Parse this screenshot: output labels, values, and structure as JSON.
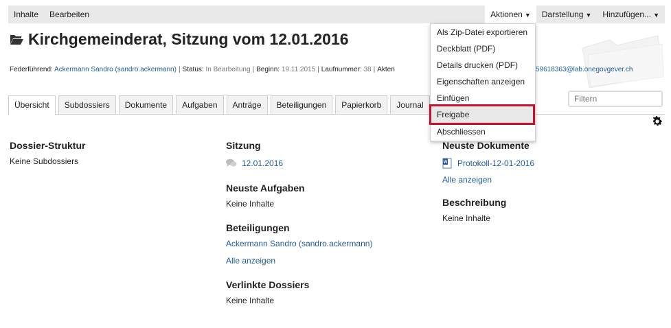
{
  "topbar": {
    "left": [
      "Inhalte",
      "Bearbeiten"
    ],
    "right": [
      {
        "label": "Aktionen",
        "caret": "▼"
      },
      {
        "label": "Darstellung",
        "caret": "▼"
      },
      {
        "label": "Hinzufügen...",
        "caret": "▼"
      }
    ]
  },
  "page_title": "Kirchgemeinderat, Sitzung vom 12.01.2016",
  "meta": {
    "federfuehrend_label": "Federführend:",
    "federfuehrend_value": "Ackermann Sandro (sandro.ackermann)",
    "status_label": "Status:",
    "status_value": "In Bearbeitung",
    "beginn_label": "Beginn:",
    "beginn_value": "19.11.2015",
    "laufnummer_label": "Laufnummer:",
    "laufnummer_value": "38",
    "akten_label": "Akten",
    "email_fragment": "59618363@lab.onegovgever.ch"
  },
  "tabs": [
    "Übersicht",
    "Subdossiers",
    "Dokumente",
    "Aufgaben",
    "Anträge",
    "Beteiligungen",
    "Papierkorb",
    "Journal"
  ],
  "filter_placeholder": "Filtern",
  "dropdown": [
    "Als Zip-Datei exportieren",
    "Deckblatt (PDF)",
    "Details drucken (PDF)",
    "Eigenschaften anzeigen",
    "Einfügen",
    "Freigabe",
    "Abschliessen"
  ],
  "col1": {
    "heading": "Dossier-Struktur",
    "text": "Keine Subdossiers"
  },
  "col2": {
    "sitzung_heading": "Sitzung",
    "sitzung_link": "12.01.2016",
    "aufgaben_heading": "Neuste Aufgaben",
    "aufgaben_text": "Keine Inhalte",
    "beteiligungen_heading": "Beteiligungen",
    "beteiligungen_link": "Ackermann Sandro (sandro.ackermann)",
    "beteiligungen_all": "Alle anzeigen",
    "verlinkte_heading": "Verlinkte Dossiers",
    "verlinkte_text": "Keine Inhalte"
  },
  "col3": {
    "dokumente_heading": "Neuste Dokumente",
    "dokument_link": "Protokoll-12-01-2016",
    "dokumente_all": "Alle anzeigen",
    "beschreibung_heading": "Beschreibung",
    "beschreibung_text": "Keine Inhalte"
  },
  "icons": {
    "title": "folder-open-icon",
    "settings": "gear-icon",
    "sitzung": "comments-icon",
    "document": "word-document-icon"
  },
  "colors": {
    "link": "#1f5c99",
    "highlight": "#c8102e",
    "topbar": "#e9e9e9"
  }
}
